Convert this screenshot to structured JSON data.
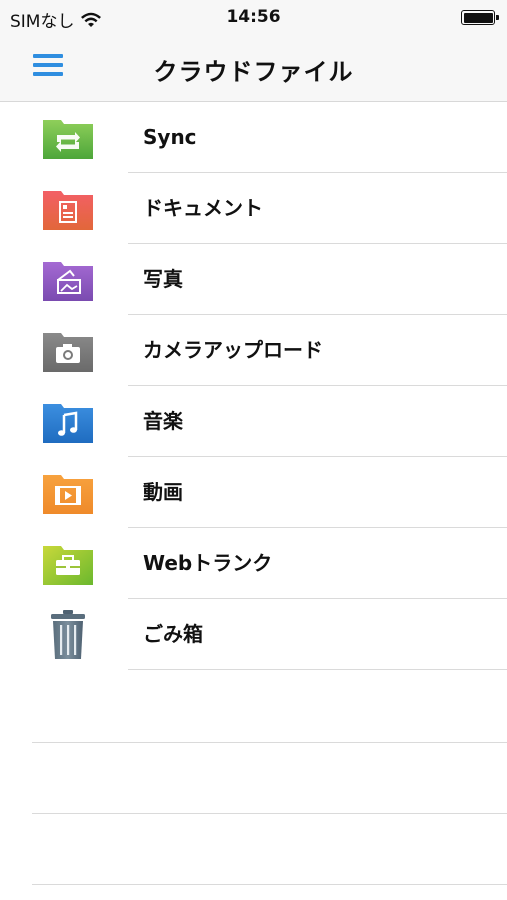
{
  "status_bar": {
    "carrier": "SIMなし",
    "time": "14:56",
    "icons": [
      "wifi-icon",
      "battery-icon"
    ]
  },
  "nav": {
    "title": "クラウドファイル",
    "menu_icon": "hamburger-menu-icon",
    "accent_color": "#2f8ee0"
  },
  "items": [
    {
      "label": "Sync",
      "icon": "sync-folder-icon",
      "color_top": "#8fcf5a",
      "color_bottom": "#4da63a"
    },
    {
      "label": "ドキュメント",
      "icon": "document-folder-icon",
      "color_top": "#f35f66",
      "color_bottom": "#e2673a"
    },
    {
      "label": "写真",
      "icon": "photo-folder-icon",
      "color_top": "#a56ad3",
      "color_bottom": "#7a4bb0"
    },
    {
      "label": "カメラアップロード",
      "icon": "camera-folder-icon",
      "color_top": "#8a8a8a",
      "color_bottom": "#6a6a6a"
    },
    {
      "label": "音楽",
      "icon": "music-folder-icon",
      "color_top": "#3c8fe0",
      "color_bottom": "#1f6cc0"
    },
    {
      "label": "動画",
      "icon": "video-folder-icon",
      "color_top": "#f7a23e",
      "color_bottom": "#ef8a2a"
    },
    {
      "label": "Webトランク",
      "icon": "webtrunk-folder-icon",
      "color_top": "#c8d83a",
      "color_bottom": "#6bb82e"
    },
    {
      "label": "ごみ箱",
      "icon": "trash-icon",
      "color_top": "#6f8291",
      "color_bottom": "#4f6272"
    }
  ]
}
